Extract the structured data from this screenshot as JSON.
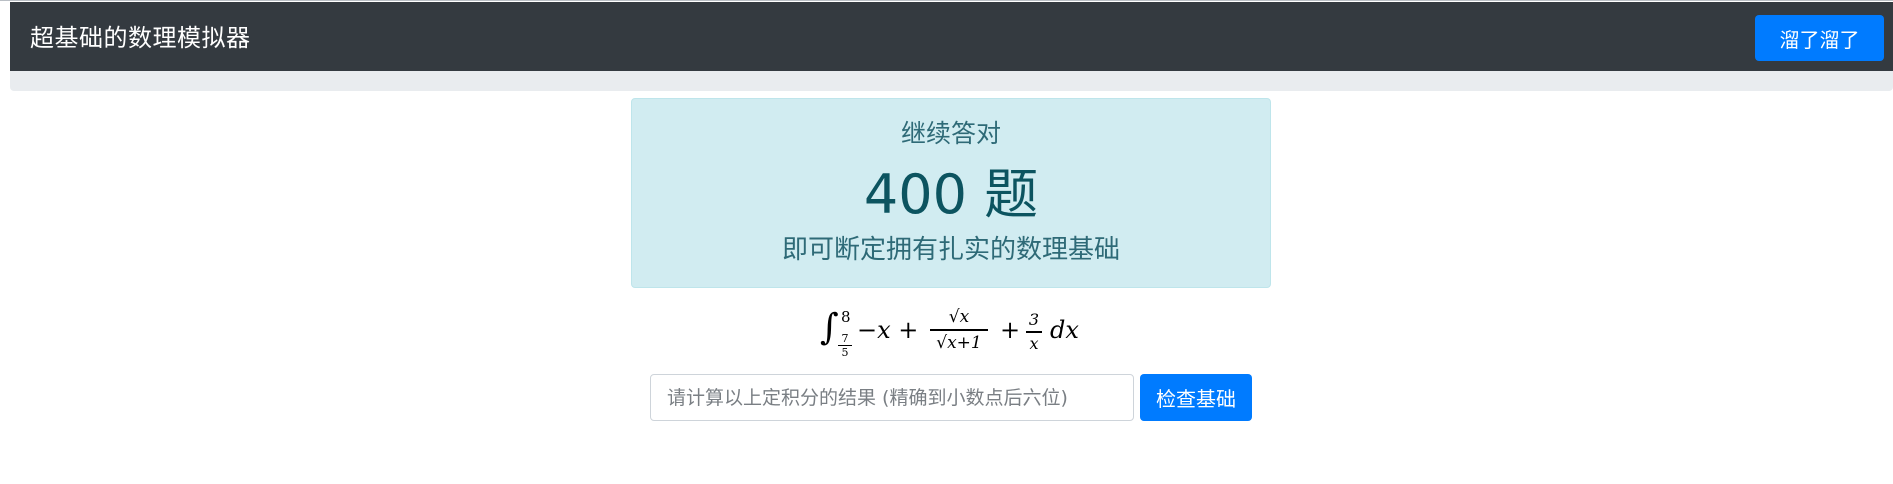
{
  "navbar": {
    "brand": "超基础的数理模拟器",
    "action_button": "溜了溜了"
  },
  "info_card": {
    "line1": "继续答对",
    "count": "400 题",
    "line3": "即可断定拥有扎实的数理基础"
  },
  "problem": {
    "integral_upper": "8",
    "integral_lower_num": "7",
    "integral_lower_den": "5",
    "term1": "−x +",
    "frac1_num": "√x",
    "frac1_den": "√x+1",
    "plus": "+",
    "frac2_num": "3",
    "frac2_den": "x",
    "differential": "dx"
  },
  "answer": {
    "placeholder": "请计算以上定积分的结果 (精确到小数点后六位)",
    "value": ""
  },
  "check_button": "检查基础",
  "colors": {
    "navbar_bg": "#343a40",
    "primary": "#007bff",
    "info_bg": "#d1ecf1",
    "info_text": "#0c5460"
  }
}
